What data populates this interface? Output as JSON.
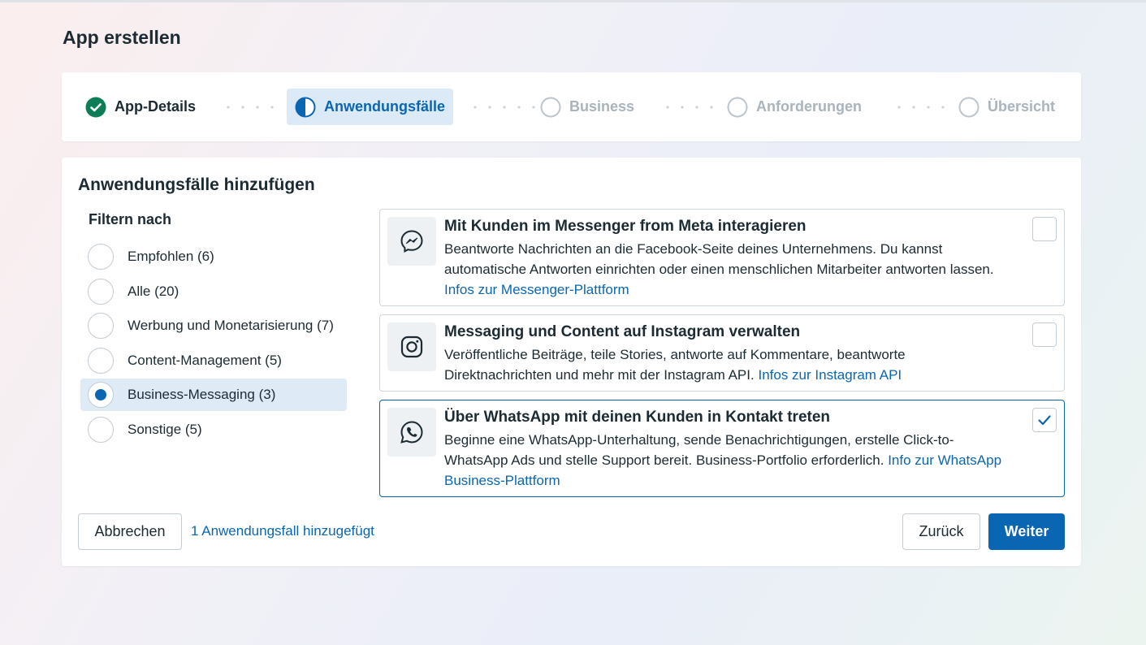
{
  "page": {
    "title": "App erstellen"
  },
  "stepper": {
    "steps": [
      {
        "label": "App-Details",
        "state": "done"
      },
      {
        "label": "Anwendungsfälle",
        "state": "active"
      },
      {
        "label": "Business",
        "state": "todo"
      },
      {
        "label": "Anforderungen",
        "state": "todo"
      },
      {
        "label": "Übersicht",
        "state": "todo"
      }
    ]
  },
  "card": {
    "title": "Anwendungsfälle hinzufügen"
  },
  "filter": {
    "title": "Filtern nach",
    "items": [
      {
        "label": "Empfohlen (6)",
        "selected": false
      },
      {
        "label": "Alle (20)",
        "selected": false
      },
      {
        "label": "Werbung und Monetarisierung (7)",
        "selected": false
      },
      {
        "label": "Content-Management (5)",
        "selected": false
      },
      {
        "label": "Business-Messaging (3)",
        "selected": true
      },
      {
        "label": "Sonstige (5)",
        "selected": false
      }
    ]
  },
  "usecases": [
    {
      "icon": "messenger-icon",
      "title": "Mit Kunden im Messenger from Meta interagieren",
      "desc": "Beantworte Nachrichten an die Facebook-Seite deines Unternehmens. Du kannst automatische Antworten einrichten oder einen menschlichen Mitarbeiter antworten lassen.",
      "link": "Infos zur Messenger-Plattform",
      "checked": false
    },
    {
      "icon": "instagram-icon",
      "title": "Messaging und Content auf Instagram verwalten",
      "desc": "Veröffentliche Beiträge, teile Stories, antworte auf Kommentare, beantworte Direktnachrichten und mehr mit der Instagram API.",
      "link": "Infos zur Instagram API",
      "checked": false
    },
    {
      "icon": "whatsapp-icon",
      "title": "Über WhatsApp mit deinen Kunden in Kontakt treten",
      "desc": "Beginne eine WhatsApp-Unterhaltung, sende Benachrichtigungen, erstelle Click-to-WhatsApp Ads und stelle Support bereit. Business-Portfolio erforderlich.",
      "link": "Info zur WhatsApp Business-Plattform",
      "checked": true
    }
  ],
  "footer": {
    "cancel_label": "Abbrechen",
    "added_text": "1 Anwendungsfall hinzugefügt",
    "back_label": "Zurück",
    "next_label": "Weiter"
  },
  "colors": {
    "accent": "#0a66b2",
    "done_green": "#0c7d57"
  }
}
